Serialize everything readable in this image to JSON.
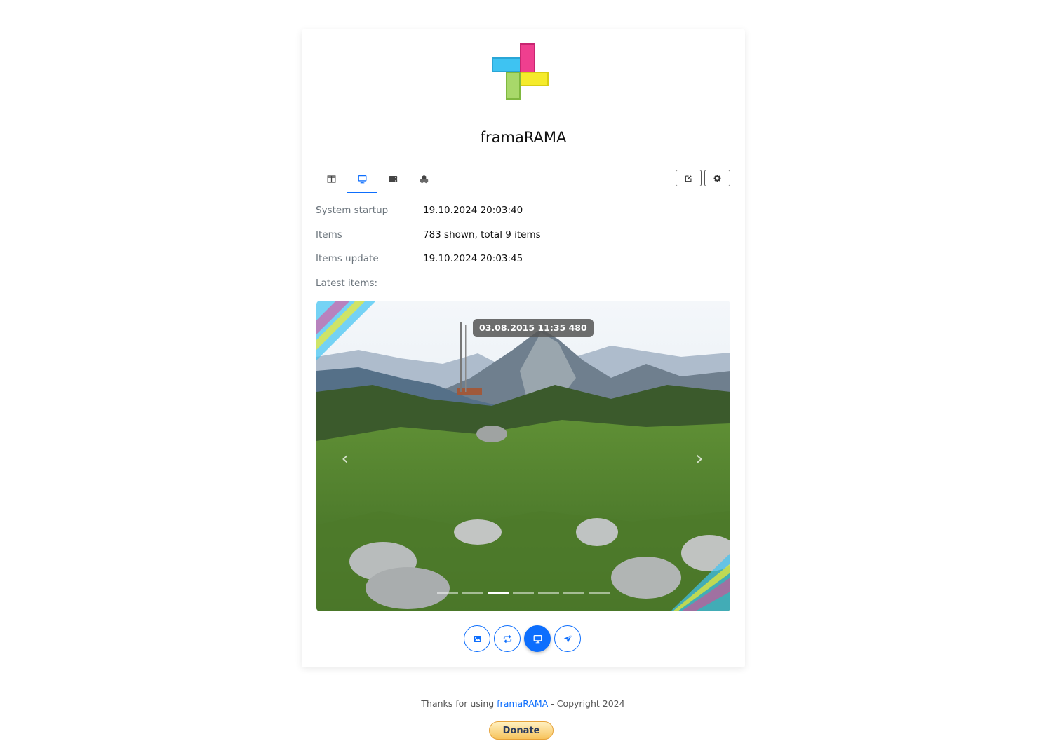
{
  "app": {
    "title": "framaRAMA"
  },
  "tabs": [
    {
      "name": "tab-overview",
      "icon": "columns-icon",
      "active": false
    },
    {
      "name": "tab-monitor",
      "icon": "desktop-icon",
      "active": true
    },
    {
      "name": "tab-server",
      "icon": "server-icon",
      "active": false
    },
    {
      "name": "tab-components",
      "icon": "cubes-icon",
      "active": false
    }
  ],
  "toolbar": {
    "edit_icon": "edit-icon",
    "settings_icon": "gear-icon"
  },
  "info": {
    "startup_label": "System startup",
    "startup_value": "19.10.2024 20:03:40",
    "items_label": "Items",
    "items_value": "783 shown, total 9 items",
    "update_label": "Items update",
    "update_value": "19.10.2024 20:03:45",
    "latest_label": "Latest items:"
  },
  "carousel": {
    "timestamp": "03.08.2015 11:35 480",
    "prev": "‹",
    "next": "›",
    "indicator_count": 7,
    "active_index": 2,
    "image": "mountain-landscape-photo"
  },
  "actions": [
    {
      "name": "image-button",
      "icon": "image-icon",
      "active": false
    },
    {
      "name": "repeat-button",
      "icon": "repeat-icon",
      "active": false
    },
    {
      "name": "display-button",
      "icon": "desktop-icon",
      "active": true
    },
    {
      "name": "send-button",
      "icon": "paper-plane-icon",
      "active": false
    }
  ],
  "footer": {
    "prefix": "Thanks for using ",
    "link": "framaRAMA",
    "suffix": " - Copyright 2024",
    "donate": "Donate"
  },
  "colors": {
    "accent": "#0d6efd",
    "logo": [
      "#3ec3f2",
      "#ef3f8f",
      "#f5eb2b",
      "#9fd55a"
    ]
  }
}
